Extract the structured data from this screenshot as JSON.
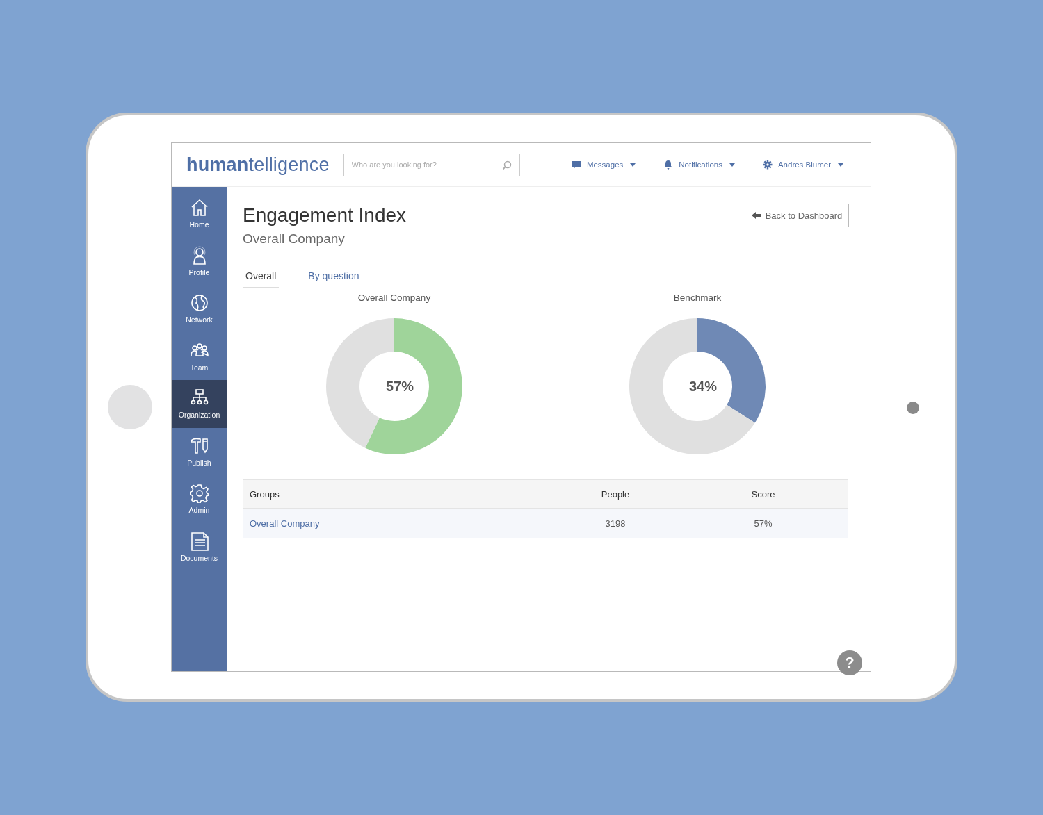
{
  "header": {
    "logo": {
      "part_1": "human",
      "part_2": "telligence"
    },
    "search": {
      "placeholder": "Who are you looking for?"
    },
    "menus": [
      {
        "kind": "messages",
        "label": "Messages"
      },
      {
        "kind": "notifications",
        "label": "Notifications"
      },
      {
        "kind": "settings",
        "label": "Andres Blumer"
      }
    ]
  },
  "sidebar": {
    "items": [
      {
        "kind": "home",
        "label": "Home",
        "selected": false
      },
      {
        "kind": "profile",
        "label": "Profile",
        "selected": false
      },
      {
        "kind": "network",
        "label": "Network",
        "selected": false
      },
      {
        "kind": "team",
        "label": "Team",
        "selected": false
      },
      {
        "kind": "organization",
        "label": "Organization",
        "selected": true
      },
      {
        "kind": "publish",
        "label": "Publish",
        "selected": false
      },
      {
        "kind": "admin",
        "label": "Admin",
        "selected": false
      },
      {
        "kind": "documents",
        "label": "Documents",
        "selected": false
      }
    ]
  },
  "page": {
    "title": "Engagement Index",
    "subtitle": "Overall Company",
    "back_button": "Back to Dashboard"
  },
  "tabs": [
    {
      "label": "Overall",
      "selected": true
    },
    {
      "label": "By question",
      "selected": false
    }
  ],
  "charts": [
    {
      "title": "Overall Company",
      "center_label": "57%",
      "chart_data": {
        "type": "donut",
        "values": [
          57,
          43
        ],
        "colors": [
          "#9fd49a",
          "#e0e0e0"
        ]
      }
    },
    {
      "title": "Benchmark",
      "center_label": "34%",
      "chart_data": {
        "type": "donut",
        "values": [
          34,
          66
        ],
        "colors": [
          "#6f89b5",
          "#e0e0e0"
        ]
      }
    }
  ],
  "table": {
    "columns": [
      "Groups",
      "People",
      "Score"
    ],
    "rows": [
      [
        "Overall Company",
        "3198",
        "57%"
      ]
    ]
  },
  "help_button": "?"
}
